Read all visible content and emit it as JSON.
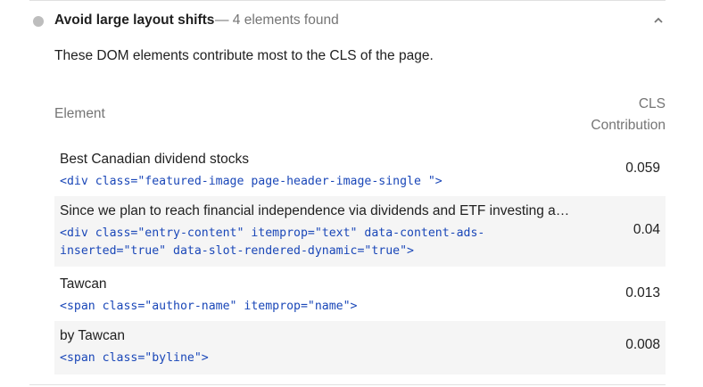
{
  "audit": {
    "title": "Avoid large layout shifts",
    "count": "— 4 elements found",
    "description": "These DOM elements contribute most to the CLS of the page."
  },
  "table": {
    "col_element": "Element",
    "col_cls_line1": "CLS",
    "col_cls_line2": "Contribution",
    "rows": [
      {
        "title": "Best Canadian dividend stocks",
        "code": "<div class=\"featured-image page-header-image-single \">",
        "value": "0.059"
      },
      {
        "title": "Since we plan to reach financial independence via dividends and ETF investing a…",
        "code_line1": "<div class=\"entry-content\" itemprop=\"text\" data-content-ads-",
        "code_line2": "inserted=\"true\" data-slot-rendered-dynamic=\"true\">",
        "value": "0.04"
      },
      {
        "title": "Tawcan",
        "code": "<span class=\"author-name\" itemprop=\"name\">",
        "value": "0.013"
      },
      {
        "title": "by Tawcan",
        "code": "<span class=\"byline\">",
        "value": "0.008"
      }
    ]
  },
  "icons": {
    "status": "status-dot-icon",
    "toggle": "chevron-up-icon"
  },
  "colors": {
    "status_dot": "#bdbdbd",
    "code": "#1a47b8",
    "alt_row": "#f5f5f5",
    "muted_text": "#757575"
  }
}
